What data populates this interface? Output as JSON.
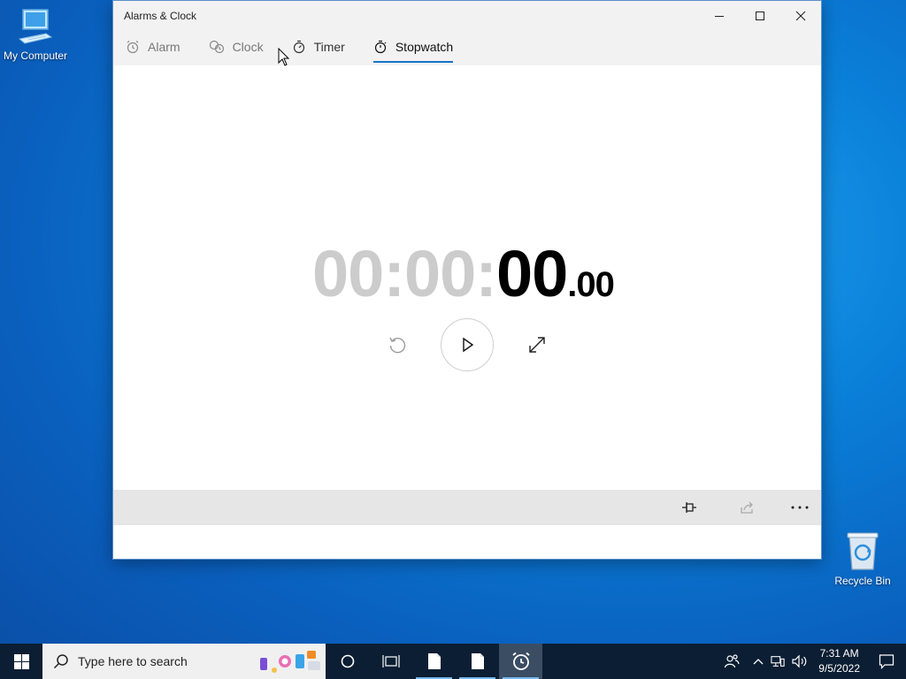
{
  "desktop": {
    "icons": [
      {
        "label": "My Computer",
        "icon": "computer-icon"
      },
      {
        "label": "Recycle Bin",
        "icon": "recycle-bin-icon"
      }
    ]
  },
  "window": {
    "title": "Alarms & Clock",
    "controls": [
      "minimize",
      "maximize",
      "close"
    ],
    "tabs": [
      {
        "label": "Alarm",
        "icon": "alarm-icon",
        "active": false
      },
      {
        "label": "Clock",
        "icon": "clock-icon",
        "active": false
      },
      {
        "label": "Timer",
        "icon": "timer-icon",
        "active": false
      },
      {
        "label": "Stopwatch",
        "icon": "stopwatch-icon",
        "active": true
      }
    ],
    "stopwatch": {
      "hours": "00",
      "sep1": ":",
      "minutes": "00",
      "sep2": ":",
      "seconds": "00",
      "hundredths": ".00"
    },
    "accent_color": "#1a73c9"
  },
  "taskbar": {
    "search_placeholder": "Type here to search",
    "time": "7:31 AM",
    "date": "9/5/2022",
    "background": "#0b1e33"
  }
}
